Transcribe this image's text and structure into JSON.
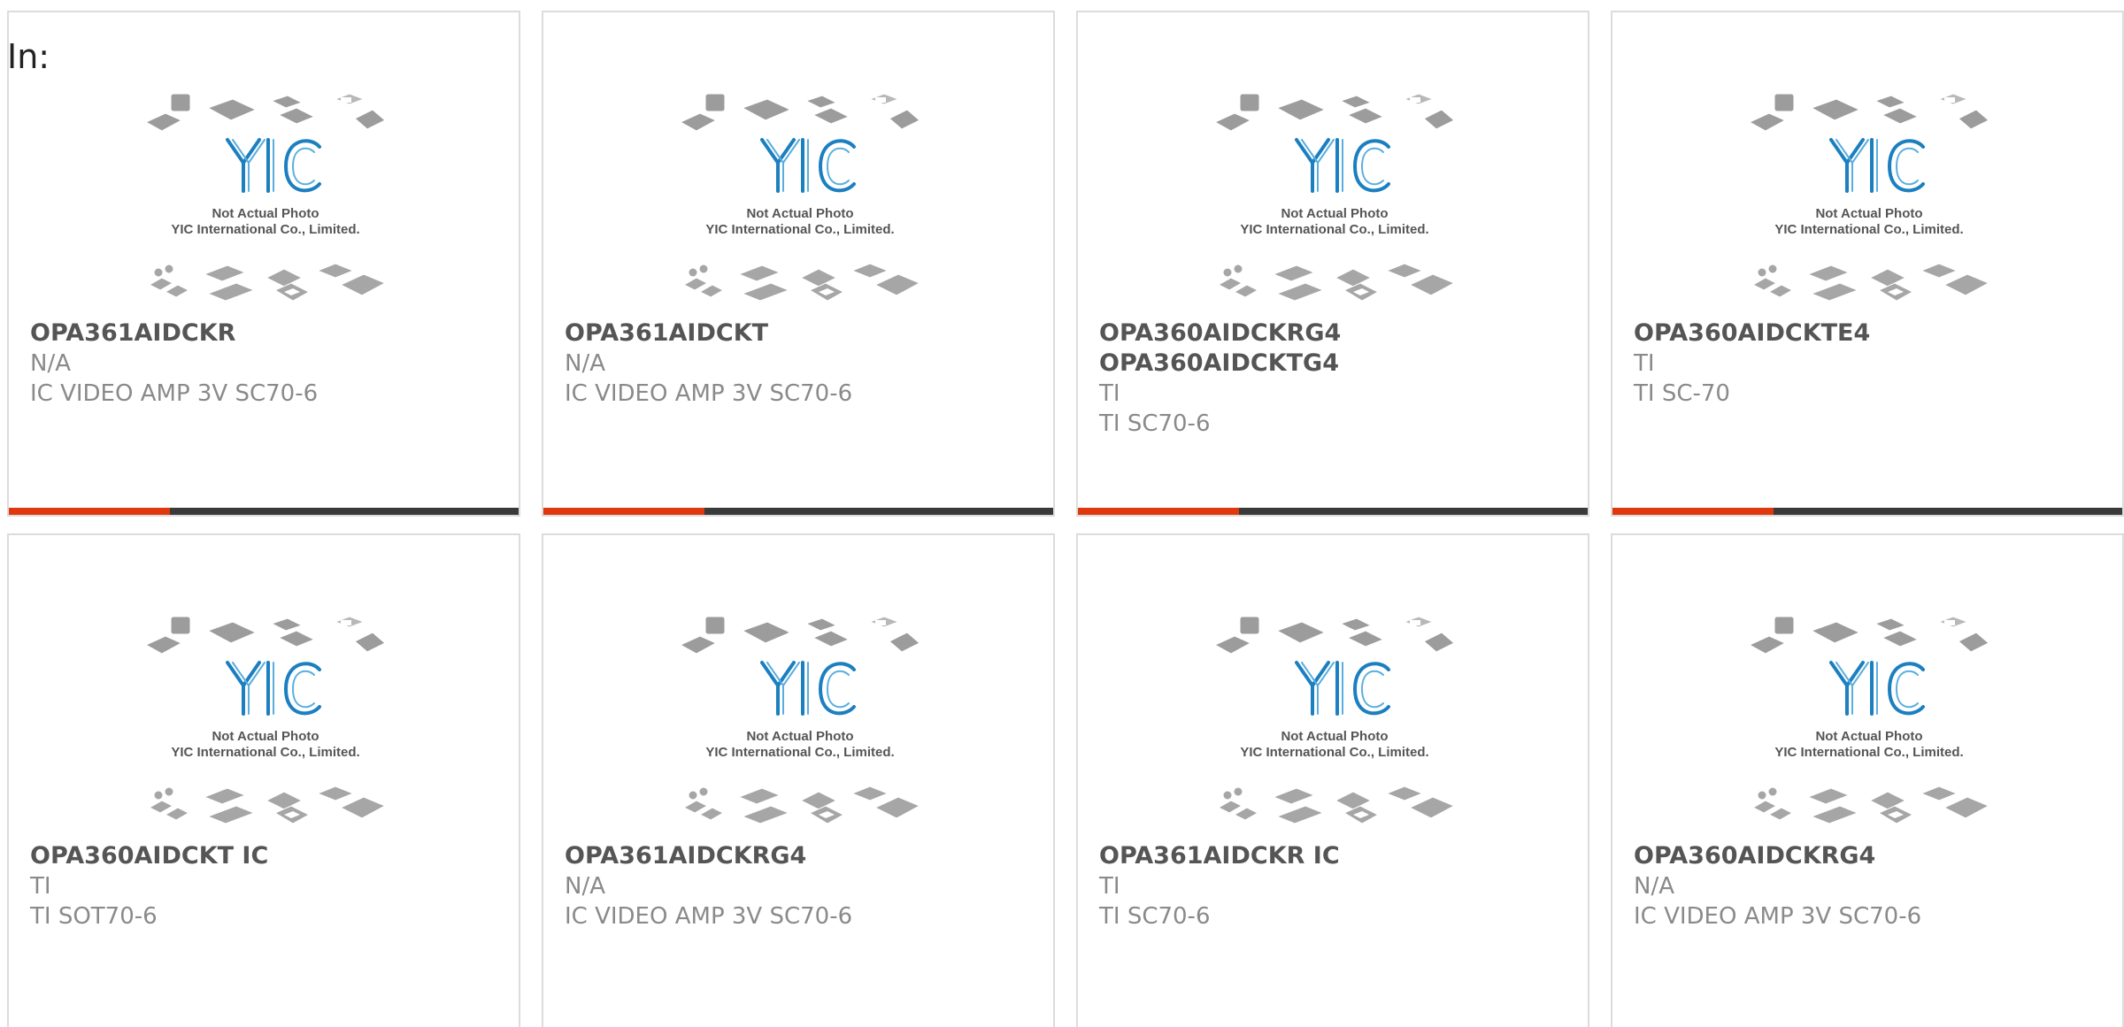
{
  "heading": "In:",
  "image_text": {
    "line1": "Not Actual Photo",
    "line2": "YIC International Co., Limited."
  },
  "colors": {
    "accent": "#e0380e",
    "bar": "#3a3a3a",
    "logo": "#1b7fc0"
  },
  "products": [
    {
      "lines": [
        "OPA361AIDCKR"
      ],
      "manufacturer": "N/A",
      "description": "IC VIDEO AMP 3V SC70-6"
    },
    {
      "lines": [
        "OPA361AIDCKT"
      ],
      "manufacturer": "N/A",
      "description": "IC VIDEO AMP 3V SC70-6"
    },
    {
      "lines": [
        "OPA360AIDCKRG4",
        "OPA360AIDCKTG4"
      ],
      "manufacturer": "TI",
      "description": "TI SC70-6"
    },
    {
      "lines": [
        "OPA360AIDCKTE4"
      ],
      "manufacturer": "TI",
      "description": "TI SC-70"
    },
    {
      "lines": [
        "OPA360AIDCKT IC"
      ],
      "manufacturer": "TI",
      "description": "TI SOT70-6"
    },
    {
      "lines": [
        "OPA361AIDCKRG4"
      ],
      "manufacturer": "N/A",
      "description": "IC VIDEO AMP 3V SC70-6"
    },
    {
      "lines": [
        "OPA361AIDCKR IC"
      ],
      "manufacturer": "TI",
      "description": "TI SC70-6"
    },
    {
      "lines": [
        "OPA360AIDCKRG4"
      ],
      "manufacturer": "N/A",
      "description": "IC VIDEO AMP 3V SC70-6"
    }
  ]
}
